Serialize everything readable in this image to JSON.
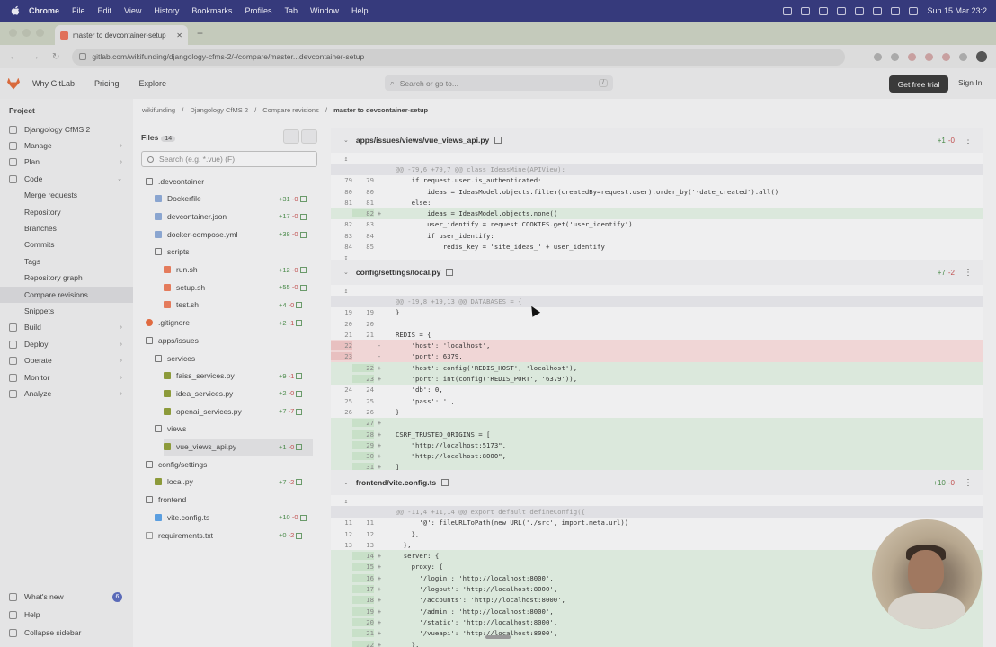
{
  "menubar": {
    "app": "Chrome",
    "items": [
      "File",
      "Edit",
      "View",
      "History",
      "Bookmarks",
      "Profiles",
      "Tab",
      "Window",
      "Help"
    ],
    "clock": "Sun 15 Mar  23:2"
  },
  "browser": {
    "tab_title": "master to devcontainer-setup",
    "url": "gitlab.com/wikifunding/djangology-cfms-2/-/compare/master...devcontainer-setup"
  },
  "gitlab_header": {
    "links": [
      "Why GitLab",
      "Pricing",
      "Explore"
    ],
    "search_placeholder": "Search or go to...",
    "search_key": "/",
    "trial_button": "Get free trial",
    "signin": "Sign In"
  },
  "sidebar": {
    "heading": "Project",
    "project_name": "Djangology CfMS 2",
    "items": [
      {
        "label": "Manage",
        "type": "group"
      },
      {
        "label": "Plan",
        "type": "group"
      },
      {
        "label": "Code",
        "type": "group",
        "open": true
      },
      {
        "label": "Merge requests",
        "type": "sub"
      },
      {
        "label": "Repository",
        "type": "sub"
      },
      {
        "label": "Branches",
        "type": "sub"
      },
      {
        "label": "Commits",
        "type": "sub"
      },
      {
        "label": "Tags",
        "type": "sub"
      },
      {
        "label": "Repository graph",
        "type": "sub"
      },
      {
        "label": "Compare revisions",
        "type": "sub",
        "active": true
      },
      {
        "label": "Snippets",
        "type": "sub"
      },
      {
        "label": "Build",
        "type": "group"
      },
      {
        "label": "Deploy",
        "type": "group"
      },
      {
        "label": "Operate",
        "type": "group"
      },
      {
        "label": "Monitor",
        "type": "group"
      },
      {
        "label": "Analyze",
        "type": "group"
      }
    ],
    "footer": [
      {
        "label": "What's new",
        "badge": "6"
      },
      {
        "label": "Help"
      },
      {
        "label": "Collapse sidebar"
      }
    ]
  },
  "breadcrumb": [
    "wikifunding",
    "Djangology CfMS 2",
    "Compare revisions",
    "master to devcontainer-setup"
  ],
  "files": {
    "title": "Files",
    "count": "14",
    "search_placeholder": "Search (e.g. *.vue) (F)",
    "tree": [
      {
        "name": ".devcontainer",
        "kind": "folder",
        "depth": 0
      },
      {
        "name": "Dockerfile",
        "kind": "file",
        "depth": 1,
        "add": "+31",
        "del": "-0"
      },
      {
        "name": "devcontainer.json",
        "kind": "file",
        "depth": 1,
        "add": "+17",
        "del": "-0"
      },
      {
        "name": "docker-compose.yml",
        "kind": "file",
        "depth": 1,
        "add": "+38",
        "del": "-0"
      },
      {
        "name": "scripts",
        "kind": "folder",
        "depth": 1
      },
      {
        "name": "run.sh",
        "kind": "sh",
        "depth": 2,
        "add": "+12",
        "del": "-0"
      },
      {
        "name": "setup.sh",
        "kind": "sh",
        "depth": 2,
        "add": "+55",
        "del": "-0"
      },
      {
        "name": "test.sh",
        "kind": "sh",
        "depth": 2,
        "add": "+4",
        "del": "-0"
      },
      {
        "name": ".gitignore",
        "kind": "git",
        "depth": 0,
        "add": "+2",
        "del": "-1"
      },
      {
        "name": "apps/issues",
        "kind": "folder",
        "depth": 0
      },
      {
        "name": "services",
        "kind": "folder",
        "depth": 1
      },
      {
        "name": "faiss_services.py",
        "kind": "py",
        "depth": 2,
        "add": "+9",
        "del": "-1"
      },
      {
        "name": "idea_services.py",
        "kind": "py",
        "depth": 2,
        "add": "+2",
        "del": "-0"
      },
      {
        "name": "openai_services.py",
        "kind": "py",
        "depth": 2,
        "add": "+7",
        "del": "-7"
      },
      {
        "name": "views",
        "kind": "folder",
        "depth": 1
      },
      {
        "name": "vue_views_api.py",
        "kind": "py",
        "depth": 2,
        "add": "+1",
        "del": "-0",
        "selected": true
      },
      {
        "name": "config/settings",
        "kind": "folder",
        "depth": 0
      },
      {
        "name": "local.py",
        "kind": "py",
        "depth": 1,
        "add": "+7",
        "del": "-2"
      },
      {
        "name": "frontend",
        "kind": "folder",
        "depth": 0
      },
      {
        "name": "vite.config.ts",
        "kind": "vue",
        "depth": 1,
        "add": "+10",
        "del": "-0"
      },
      {
        "name": "requirements.txt",
        "kind": "txt",
        "depth": 0,
        "add": "+0",
        "del": "-2"
      }
    ]
  },
  "diffs": [
    {
      "file": "apps/issues/views/vue_views_api.py",
      "add": "+1",
      "del": "-0",
      "lines": [
        {
          "t": "exp",
          "o": "",
          "n": "",
          "m": "↥",
          "c": ""
        },
        {
          "t": "hunk",
          "o": "",
          "n": "",
          "m": "",
          "c": "@@ -79,6 +79,7 @@ class IdeasMine(APIView):"
        },
        {
          "t": "ctx",
          "o": "79",
          "n": "79",
          "m": "",
          "c": "    if request.user.is_authenticated:"
        },
        {
          "t": "ctx",
          "o": "80",
          "n": "80",
          "m": "",
          "c": "        ideas = IdeasModel.objects.filter(createdBy=request.user).order_by('-date_created').all()"
        },
        {
          "t": "ctx",
          "o": "81",
          "n": "81",
          "m": "",
          "c": "    else:"
        },
        {
          "t": "add",
          "o": "",
          "n": "82",
          "m": "+",
          "c": "        ideas = IdeasModel.objects.none()"
        },
        {
          "t": "ctx",
          "o": "82",
          "n": "83",
          "m": "",
          "c": "        user_identify = request.COOKIES.get('user_identify')"
        },
        {
          "t": "ctx",
          "o": "83",
          "n": "84",
          "m": "",
          "c": "        if user_identify:"
        },
        {
          "t": "ctx",
          "o": "84",
          "n": "85",
          "m": "",
          "c": "            redis_key = 'site_ideas_' + user_identify"
        },
        {
          "t": "exp",
          "o": "",
          "n": "",
          "m": "↧",
          "c": ""
        }
      ]
    },
    {
      "file": "config/settings/local.py",
      "add": "+7",
      "del": "-2",
      "lines": [
        {
          "t": "exp",
          "o": "",
          "n": "",
          "m": "↥",
          "c": ""
        },
        {
          "t": "hunk",
          "o": "",
          "n": "",
          "m": "",
          "c": "@@ -19,8 +19,13 @@ DATABASES = {"
        },
        {
          "t": "ctx",
          "o": "19",
          "n": "19",
          "m": "",
          "c": "}"
        },
        {
          "t": "ctx",
          "o": "20",
          "n": "20",
          "m": "",
          "c": ""
        },
        {
          "t": "ctx",
          "o": "21",
          "n": "21",
          "m": "",
          "c": "REDIS = {"
        },
        {
          "t": "del",
          "o": "22",
          "n": "",
          "m": "-",
          "c": "    'host': 'localhost',"
        },
        {
          "t": "del",
          "o": "23",
          "n": "",
          "m": "-",
          "c": "    'port': 6379,"
        },
        {
          "t": "add",
          "o": "",
          "n": "22",
          "m": "+",
          "c": "    'host': config('REDIS_HOST', 'localhost'),"
        },
        {
          "t": "add",
          "o": "",
          "n": "23",
          "m": "+",
          "c": "    'port': int(config('REDIS_PORT', '6379')),"
        },
        {
          "t": "ctx",
          "o": "24",
          "n": "24",
          "m": "",
          "c": "    'db': 0,"
        },
        {
          "t": "ctx",
          "o": "25",
          "n": "25",
          "m": "",
          "c": "    'pass': '',"
        },
        {
          "t": "ctx",
          "o": "26",
          "n": "26",
          "m": "",
          "c": "}"
        },
        {
          "t": "add",
          "o": "",
          "n": "27",
          "m": "+",
          "c": ""
        },
        {
          "t": "add",
          "o": "",
          "n": "28",
          "m": "+",
          "c": "CSRF_TRUSTED_ORIGINS = ["
        },
        {
          "t": "add",
          "o": "",
          "n": "29",
          "m": "+",
          "c": "    \"http://localhost:5173\","
        },
        {
          "t": "add",
          "o": "",
          "n": "30",
          "m": "+",
          "c": "    \"http://localhost:8000\","
        },
        {
          "t": "add",
          "o": "",
          "n": "31",
          "m": "+",
          "c": "]"
        }
      ]
    },
    {
      "file": "frontend/vite.config.ts",
      "add": "+10",
      "del": "-0",
      "lines": [
        {
          "t": "exp",
          "o": "",
          "n": "",
          "m": "↥",
          "c": ""
        },
        {
          "t": "hunk",
          "o": "",
          "n": "",
          "m": "",
          "c": "@@ -11,4 +11,14 @@ export default defineConfig({"
        },
        {
          "t": "ctx",
          "o": "11",
          "n": "11",
          "m": "",
          "c": "      '@': fileURLToPath(new URL('./src', import.meta.url))"
        },
        {
          "t": "ctx",
          "o": "12",
          "n": "12",
          "m": "",
          "c": "    },"
        },
        {
          "t": "ctx",
          "o": "13",
          "n": "13",
          "m": "",
          "c": "  },"
        },
        {
          "t": "add",
          "o": "",
          "n": "14",
          "m": "+",
          "c": "  server: {"
        },
        {
          "t": "add",
          "o": "",
          "n": "15",
          "m": "+",
          "c": "    proxy: {"
        },
        {
          "t": "add",
          "o": "",
          "n": "16",
          "m": "+",
          "c": "      '/login': 'http://localhost:8000',"
        },
        {
          "t": "add",
          "o": "",
          "n": "17",
          "m": "+",
          "c": "      '/logout': 'http://localhost:8000',"
        },
        {
          "t": "add",
          "o": "",
          "n": "18",
          "m": "+",
          "c": "      '/accounts': 'http://localhost:8000',"
        },
        {
          "t": "add",
          "o": "",
          "n": "19",
          "m": "+",
          "c": "      '/admin': 'http://localhost:8000',"
        },
        {
          "t": "add",
          "o": "",
          "n": "20",
          "m": "+",
          "c": "      '/static': 'http://localhost:8000',"
        },
        {
          "t": "add",
          "o": "",
          "n": "21",
          "m": "+",
          "c": "      '/vueapi': 'http://localhost:8000',"
        },
        {
          "t": "add",
          "o": "",
          "n": "22",
          "m": "+",
          "c": "    },"
        }
      ]
    }
  ]
}
